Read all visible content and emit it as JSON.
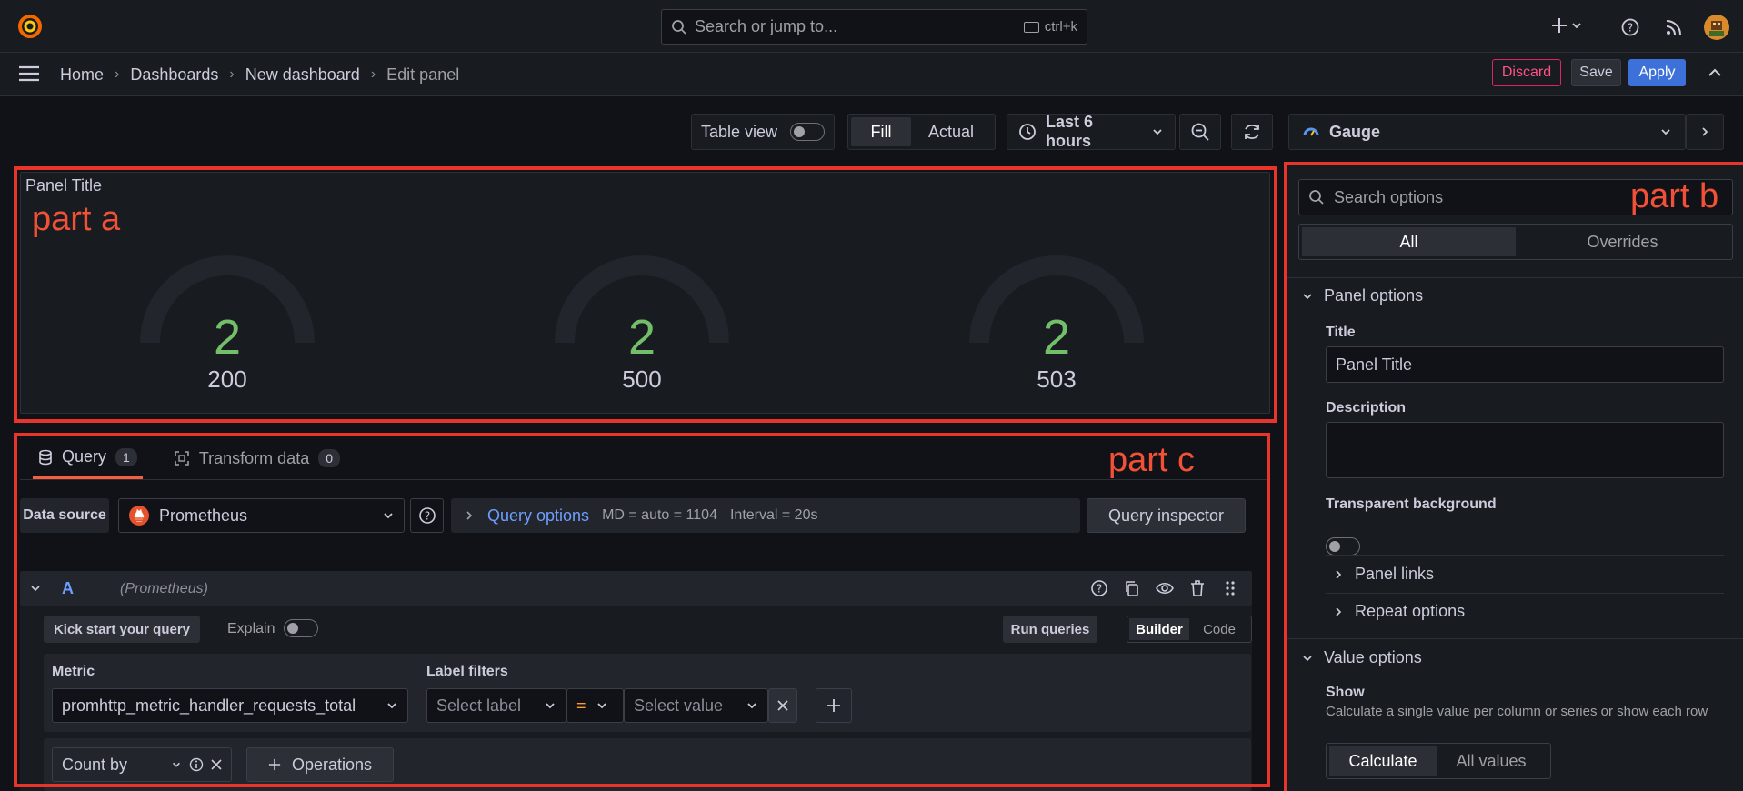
{
  "topbar": {
    "search_placeholder": "Search or jump to...",
    "shortcut": "ctrl+k"
  },
  "breadcrumb": [
    "Home",
    "Dashboards",
    "New dashboard",
    "Edit panel"
  ],
  "actions": {
    "discard": "Discard",
    "save": "Save",
    "apply": "Apply"
  },
  "toolbar": {
    "table_view": "Table view",
    "fill": "Fill",
    "actual": "Actual",
    "time_range": "Last 6 hours",
    "visualization": "Gauge"
  },
  "panel": {
    "title": "Panel Title",
    "gauges": [
      {
        "value": "2",
        "label": "200"
      },
      {
        "value": "2",
        "label": "500"
      },
      {
        "value": "2",
        "label": "503"
      }
    ]
  },
  "annotations": {
    "a": "part a",
    "b": "part b",
    "c": "part c"
  },
  "query": {
    "tabs": [
      {
        "label": "Query",
        "count": "1"
      },
      {
        "label": "Transform data",
        "count": "0"
      }
    ],
    "data_source_label": "Data source",
    "data_source": "Prometheus",
    "query_options": "Query options",
    "md": "MD = auto = 1104",
    "interval": "Interval = 20s",
    "query_inspector": "Query inspector",
    "row_letter": "A",
    "row_source": "(Prometheus)",
    "kick_start": "Kick start your query",
    "explain": "Explain",
    "run_queries": "Run queries",
    "builder": "Builder",
    "code": "Code",
    "metric_label": "Metric",
    "metric_value": "promhttp_metric_handler_requests_total",
    "label_filters": "Label filters",
    "select_label": "Select label",
    "operator": "=",
    "select_value": "Select value",
    "count_by": "Count by",
    "operations": "Operations"
  },
  "options": {
    "search_placeholder": "Search options",
    "all": "All",
    "overrides": "Overrides",
    "panel_options": "Panel options",
    "title_label": "Title",
    "title_value": "Panel Title",
    "description_label": "Description",
    "transparent_label": "Transparent background",
    "panel_links": "Panel links",
    "repeat_options": "Repeat options",
    "value_options": "Value options",
    "show_label": "Show",
    "show_desc": "Calculate a single value per column or series or show each row",
    "calculate": "Calculate",
    "all_values": "All values"
  }
}
